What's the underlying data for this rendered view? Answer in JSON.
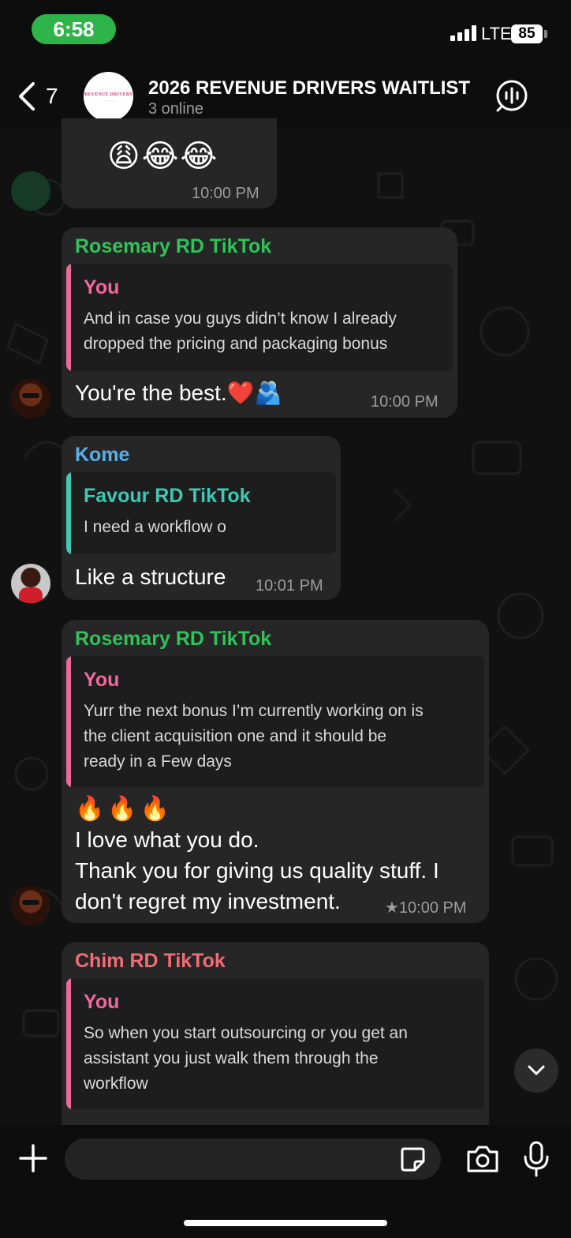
{
  "status_bar": {
    "time": "6:58",
    "network": "LTE",
    "battery": "85"
  },
  "header": {
    "back_count": "7",
    "title": "2026 REVENUE DRIVERS WAITLIST",
    "subtitle": "3 online",
    "avatar_logo_text": "REVENUE DRIVERS"
  },
  "messages": [
    {
      "text": "😩😂😂",
      "time": "10:00 PM"
    },
    {
      "sender": "Rosemary RD TikTok",
      "sender_color": "#2fc35a",
      "reply_to": {
        "name": "You",
        "name_color": "#f0679b",
        "lines": [
          "And in case you guys didn’t know I already",
          "dropped the pricing and packaging bonus"
        ]
      },
      "text": "You're the best.❤️🫂",
      "time": "10:00 PM"
    },
    {
      "sender": "Kome",
      "sender_color": "#5aaee8",
      "reply_to": {
        "name": "Favour RD TikTok",
        "name_color": "#3ec9b4",
        "lines": [
          "I need a workflow o"
        ]
      },
      "text": "Like a structure",
      "time": "10:01 PM"
    },
    {
      "sender": "Rosemary RD TikTok",
      "sender_color": "#2fc35a",
      "reply_to": {
        "name": "You",
        "name_color": "#f0679b",
        "lines": [
          "Yurr the next bonus I’m currently working on is",
          "the client acquisition one and it should be",
          "ready in a Few days"
        ]
      },
      "lines": [
        "🔥🔥🔥",
        "I love what you do.",
        "Thank you for giving us quality stuff. I",
        "don't regret my investment."
      ],
      "time": "★10:00 PM"
    },
    {
      "sender": "Chim RD TikTok",
      "sender_color": "#f36b74",
      "reply_to": {
        "name": "You",
        "name_color": "#f0679b",
        "lines": [
          "So when you start outsourcing or you get an",
          "assistant you just walk them through the",
          "workflow"
        ]
      }
    }
  ],
  "input": {
    "placeholder": ""
  }
}
